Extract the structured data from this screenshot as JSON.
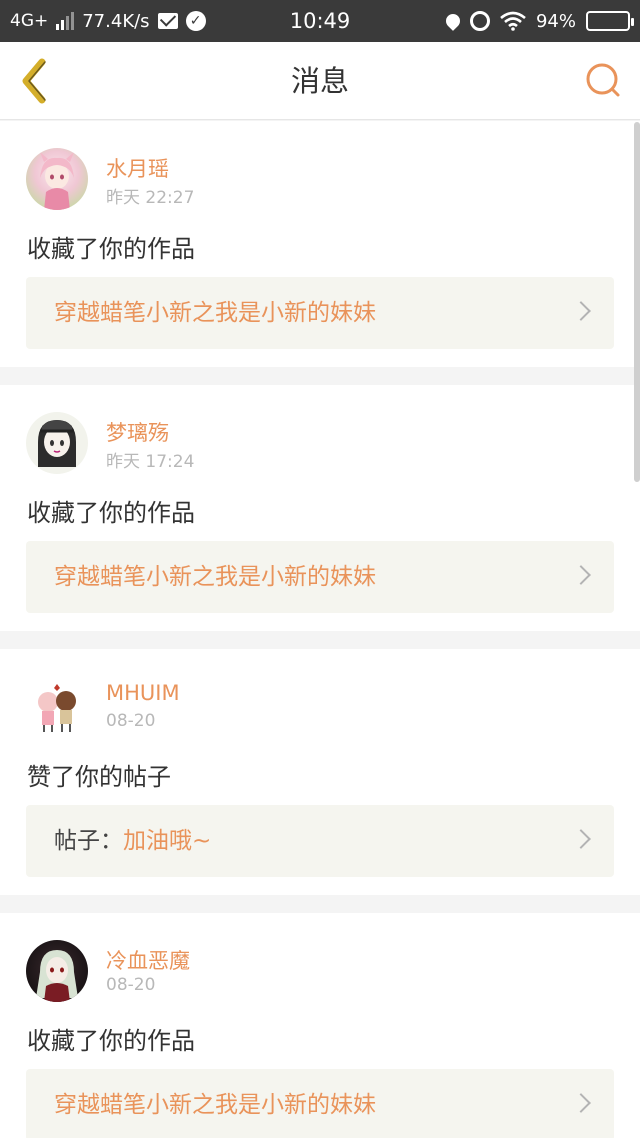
{
  "status_bar": {
    "network": "4G+",
    "speed": "77.4K/s",
    "time": "10:49",
    "battery": "94%",
    "battery_level": 0.94
  },
  "header": {
    "title": "消息"
  },
  "colors": {
    "accent": "#e9935a",
    "status_bar_bg": "#3a3a3a",
    "card_ref_bg": "#f5f5ef",
    "back_icon": "#d4ae2a"
  },
  "messages": [
    {
      "user": "水月瑶",
      "time": "昨天 22:27",
      "action": "收藏了你的作品",
      "ref_prefix": "",
      "ref_title": "穿越蜡笔小新之我是小新的妹妹",
      "avatar_icon": "anime-girl-avatar"
    },
    {
      "user": "梦璃殇",
      "time": "昨天 17:24",
      "action": "收藏了你的作品",
      "ref_prefix": "",
      "ref_title": "穿越蜡笔小新之我是小新的妹妹",
      "avatar_icon": "cap-girl-avatar"
    },
    {
      "user": "MHUIM",
      "time": "08-20",
      "action": "赞了你的帖子",
      "ref_prefix": "帖子：",
      "ref_title": "加油哦~",
      "avatar_icon": "couple-avatar"
    },
    {
      "user": "冷血恶魔",
      "time": "08-20",
      "action": "收藏了你的作品",
      "ref_prefix": "",
      "ref_title": "穿越蜡笔小新之我是小新的妹妹",
      "avatar_icon": "dark-anime-avatar"
    }
  ]
}
